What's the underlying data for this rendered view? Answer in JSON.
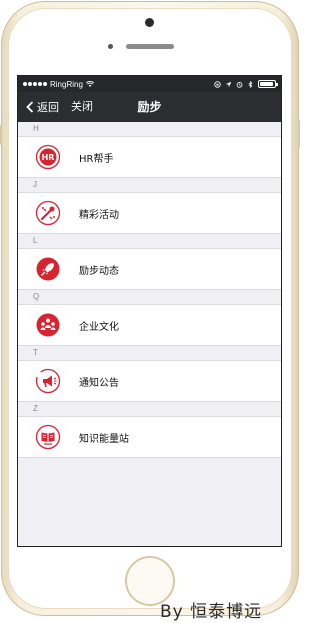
{
  "status_bar": {
    "carrier": "RingRing",
    "icons": [
      "signal-dots",
      "wifi-icon",
      "orientation-lock-icon",
      "location-icon",
      "alarm-icon",
      "bluetooth-icon",
      "battery-icon"
    ],
    "battery_level_percent": 90
  },
  "nav": {
    "back_label": "返回",
    "close_label": "关闭",
    "title": "励步"
  },
  "sections": [
    {
      "header": "H",
      "item": {
        "label": "HR帮手",
        "icon": "hr-icon"
      }
    },
    {
      "header": "J",
      "item": {
        "label": "精彩活动",
        "icon": "activity-icon"
      }
    },
    {
      "header": "L",
      "item": {
        "label": "励步动态",
        "icon": "rocket-icon"
      }
    },
    {
      "header": "Q",
      "item": {
        "label": "企业文化",
        "icon": "culture-icon"
      }
    },
    {
      "header": "T",
      "item": {
        "label": "通知公告",
        "icon": "megaphone-icon"
      }
    },
    {
      "header": "Z",
      "item": {
        "label": "知识能量站",
        "icon": "book-icon"
      }
    }
  ],
  "watermark": "By 恒泰博远",
  "colors": {
    "accent": "#d9232f",
    "nav_background": "#2c2d31",
    "list_background": "#efeff4"
  }
}
